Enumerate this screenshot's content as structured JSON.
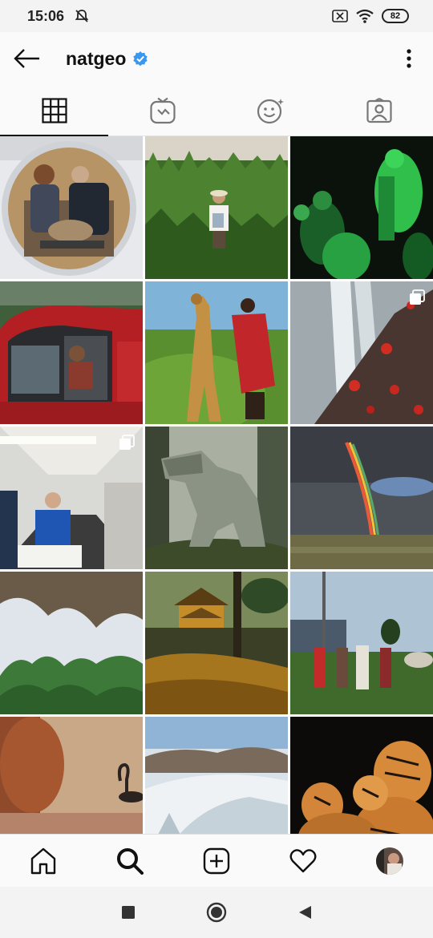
{
  "status_bar": {
    "time": "15:06",
    "battery": "82",
    "icons": [
      "do-not-disturb-icon",
      "sim-icon",
      "wifi-icon",
      "battery-icon"
    ]
  },
  "header": {
    "username": "natgeo",
    "verified": true,
    "icons": [
      "back-arrow-icon",
      "verified-badge-icon",
      "more-vertical-icon"
    ]
  },
  "tabs": [
    {
      "name": "grid",
      "icon": "grid-icon",
      "active": true
    },
    {
      "name": "igtv",
      "icon": "igtv-icon",
      "active": false
    },
    {
      "name": "reels",
      "icon": "reels-effects-icon",
      "active": false
    },
    {
      "name": "tagged",
      "icon": "tagged-user-icon",
      "active": false
    }
  ],
  "posts": [
    {
      "subject": "scientists-examining-specimen",
      "multiple": false
    },
    {
      "subject": "farmer-in-cornfield",
      "multiple": false
    },
    {
      "subject": "green-lit-night-scene",
      "multiple": false
    },
    {
      "subject": "red-car-boy",
      "multiple": false
    },
    {
      "subject": "man-with-giraffe",
      "multiple": false
    },
    {
      "subject": "red-crabs-on-rock",
      "multiple": true
    },
    {
      "subject": "man-in-hallway",
      "multiple": true
    },
    {
      "subject": "dinosaur-statue",
      "multiple": false
    },
    {
      "subject": "rainbow-over-plain",
      "multiple": false
    },
    {
      "subject": "karst-mountains-cave",
      "multiple": false
    },
    {
      "subject": "golden-pavilion-temple",
      "multiple": false
    },
    {
      "subject": "children-in-field",
      "multiple": false
    },
    {
      "subject": "swan-in-warm-water",
      "multiple": false
    },
    {
      "subject": "glacier-aerial",
      "multiple": false
    },
    {
      "subject": "tiger-cubs",
      "multiple": false
    }
  ],
  "bottom_nav": [
    {
      "name": "home",
      "icon": "home-icon"
    },
    {
      "name": "search",
      "icon": "search-icon",
      "active": true
    },
    {
      "name": "new-post",
      "icon": "add-post-icon"
    },
    {
      "name": "activity",
      "icon": "heart-icon"
    },
    {
      "name": "profile",
      "icon": "profile-avatar-icon"
    }
  ],
  "system_nav": [
    "recent-apps-icon",
    "home-circle-icon",
    "back-triangle-icon"
  ],
  "colors": {
    "verified": "#3897f0",
    "active_tab": "#111111",
    "background": "#fafafa"
  }
}
